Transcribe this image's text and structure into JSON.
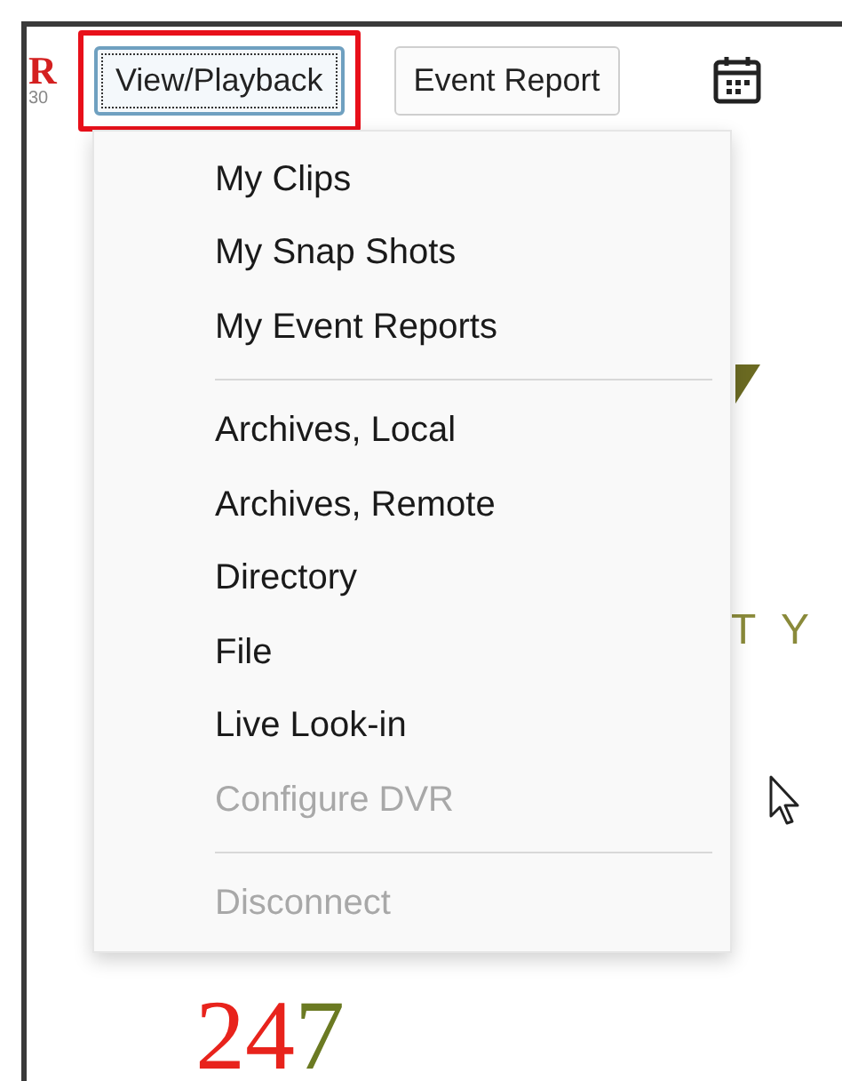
{
  "logo": {
    "letter": "R",
    "subtext": "30"
  },
  "toolbar": {
    "buttons": [
      {
        "label": "View/Playback",
        "focused": true,
        "highlighted": true
      },
      {
        "label": "Event Report",
        "focused": false,
        "highlighted": false
      }
    ]
  },
  "menu": {
    "items": [
      {
        "kind": "item",
        "label": "My Clips",
        "disabled": false
      },
      {
        "kind": "item",
        "label": "My Snap Shots",
        "disabled": false
      },
      {
        "kind": "item",
        "label": "My Event Reports",
        "disabled": false
      },
      {
        "kind": "separator"
      },
      {
        "kind": "item",
        "label": "Archives, Local",
        "disabled": false
      },
      {
        "kind": "item",
        "label": "Archives, Remote",
        "disabled": false
      },
      {
        "kind": "item",
        "label": "Directory",
        "disabled": false
      },
      {
        "kind": "item",
        "label": "File",
        "disabled": false
      },
      {
        "kind": "item",
        "label": "Live Look-in",
        "disabled": false
      },
      {
        "kind": "item",
        "label": "Configure DVR",
        "disabled": true
      },
      {
        "kind": "separator"
      },
      {
        "kind": "item",
        "label": "Disconnect",
        "disabled": true
      }
    ]
  },
  "background": {
    "partial_text": "T Y",
    "big_number": [
      {
        "text": "24",
        "color": "#e8231c"
      },
      {
        "text": "7",
        "color": "#6b7a22"
      }
    ]
  }
}
